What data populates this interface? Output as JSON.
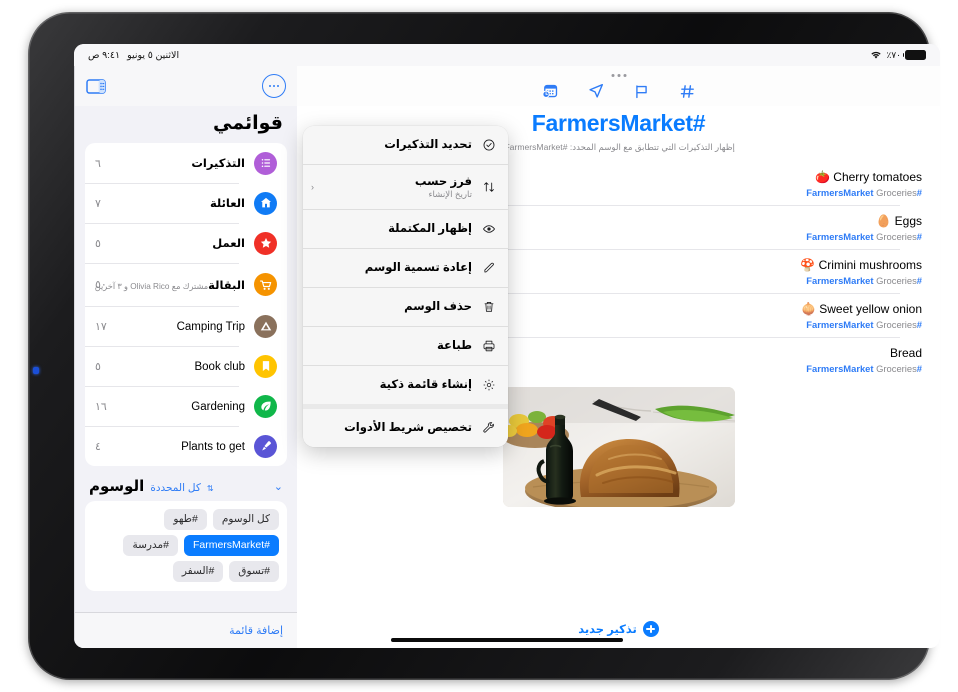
{
  "status_bar": {
    "battery_percent": "٧٠٪",
    "battery_icon": "battery-icon",
    "wifi_icon": "wifi-icon",
    "time": "٩:٤١ ص",
    "date": "الاثنين ٥ يونيو"
  },
  "sidebar": {
    "more_button": "more-options-icon",
    "sidebar_toggle": "sidebar-toggle-icon",
    "title": "قوائمي",
    "lists": [
      {
        "name": "التذكيرات",
        "count": "٦",
        "icon": "list-bullets-icon",
        "color": "#b05ed8",
        "bold": true,
        "subtitle": ""
      },
      {
        "name": "العائلة",
        "count": "٧",
        "icon": "house-icon",
        "color": "#107bf5",
        "bold": true,
        "subtitle": ""
      },
      {
        "name": "العمل",
        "count": "٥",
        "icon": "star-icon",
        "color": "#f03027",
        "bold": true,
        "subtitle": ""
      },
      {
        "name": "البقالة",
        "count": "٥٠",
        "icon": "shopping-cart-icon",
        "color": "#f59300",
        "bold": true,
        "subtitle": "مشترك مع Olivia Rico و ٣ آخرين"
      },
      {
        "name": "Camping Trip",
        "count": "١٧",
        "icon": "tent-icon",
        "color": "#8a715c",
        "bold": false,
        "subtitle": ""
      },
      {
        "name": "Book club",
        "count": "٥",
        "icon": "bookmark-icon",
        "color": "#ffc400",
        "bold": false,
        "subtitle": ""
      },
      {
        "name": "Gardening",
        "count": "١٦",
        "icon": "leaf-icon",
        "color": "#10b74a",
        "bold": false,
        "subtitle": ""
      },
      {
        "name": "Plants to get",
        "count": "٤",
        "icon": "paintbrush-icon",
        "color": "#5a55d6",
        "bold": false,
        "subtitle": ""
      }
    ],
    "tags_section": {
      "title": "الوسوم",
      "selection_label": "كل المحددة",
      "selection_stepper_icon": "up-down-chevron-icon",
      "collapse_icon": "chevron-down-icon",
      "chips": [
        {
          "label": "كل الوسوم",
          "active": false
        },
        {
          "label": "#طهو",
          "active": false
        },
        {
          "label": "#FarmersMarket",
          "active": true
        },
        {
          "label": "#مدرسة",
          "active": false
        },
        {
          "label": "#تسوق",
          "active": false
        },
        {
          "label": "#السفر",
          "active": false
        }
      ]
    },
    "add_list_label": "إضافة قائمة"
  },
  "main": {
    "grabber_icon": "multitasking-grabber-icon",
    "toolbar_icons": [
      "hashtag-icon",
      "flag-icon",
      "location-arrow-icon",
      "calendar-clock-icon"
    ],
    "title": "#FarmersMarket",
    "subtitle": "إظهار التذكيرات التي تتطابق مع الوسم المحدد: #FarmersMarket.",
    "reminders": [
      {
        "emoji": "🍅",
        "title": "Cherry tomatoes",
        "list": "Groceries",
        "tag": "#FarmersMarket"
      },
      {
        "emoji": "🥚",
        "title": "Eggs",
        "list": "Groceries",
        "tag": "#FarmersMarket"
      },
      {
        "emoji": "🍄",
        "title": "Crimini mushrooms",
        "list": "Groceries",
        "tag": "#FarmersMarket"
      },
      {
        "emoji": "🧅",
        "title": "Sweet yellow onion",
        "list": "Groceries",
        "tag": "#FarmersMarket"
      },
      {
        "emoji": "",
        "title": "Bread",
        "list": "Groceries",
        "tag": "#FarmersMarket"
      }
    ],
    "attachment": {
      "name": "bread-photo",
      "description": "رغيف خبز على لوح خشبي مع زجاجة زيت زيتون وفلفل ملون"
    },
    "new_reminder_label": "تذكير جديد",
    "add_icon": "plus-circle-icon"
  },
  "menu": {
    "items": [
      {
        "label": "تحديد التذكيرات",
        "sub": "",
        "icon": "checkmark-circle-icon",
        "chevron": false,
        "gap_after": false
      },
      {
        "label": "فرز حسب",
        "sub": "تاريخ الإنشاء",
        "icon": "sort-arrows-icon",
        "chevron": true,
        "gap_after": false
      },
      {
        "label": "إظهار المكتملة",
        "sub": "",
        "icon": "eye-icon",
        "chevron": false,
        "gap_after": false
      },
      {
        "label": "إعادة تسمية الوسم",
        "sub": "",
        "icon": "pencil-icon",
        "chevron": false,
        "gap_after": false
      },
      {
        "label": "حذف الوسم",
        "sub": "",
        "icon": "trash-icon",
        "chevron": false,
        "gap_after": false
      },
      {
        "label": "طباعة",
        "sub": "",
        "icon": "printer-icon",
        "chevron": false,
        "gap_after": false
      },
      {
        "label": "إنشاء قائمة ذكية",
        "sub": "",
        "icon": "gear-icon",
        "chevron": false,
        "gap_after": true
      },
      {
        "label": "تخصيص شريط الأدوات",
        "sub": "",
        "icon": "wrench-icon",
        "chevron": false,
        "gap_after": false
      }
    ]
  },
  "colors": {
    "accent": "#0a7cff",
    "tint": "#2f7cf6",
    "background": "#f2f2f7"
  }
}
